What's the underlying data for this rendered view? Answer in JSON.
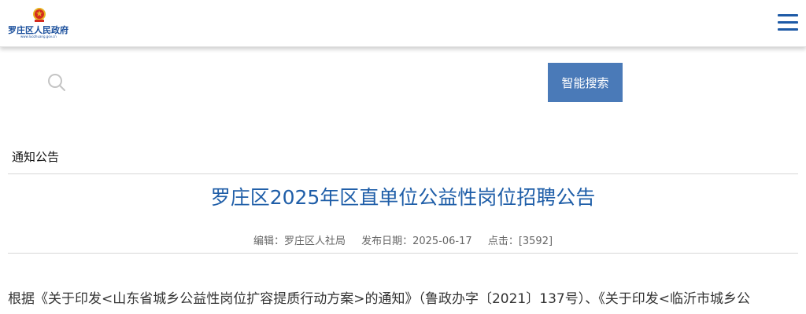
{
  "header": {
    "logo_title": "罗庄区人民政府",
    "logo_url": "www.luozhuang.gov.cn",
    "emblem_icon": "national-emblem-icon",
    "menu_icon": "hamburger-menu-icon"
  },
  "search": {
    "icon": "search-icon",
    "placeholder": "",
    "value": "",
    "button_label": "智能搜索"
  },
  "breadcrumb": {
    "label": "通知公告"
  },
  "article": {
    "title": "罗庄区2025年区直单位公益性岗位招聘公告",
    "editor": "编辑：罗庄区人社局",
    "date": "发布日期：2025-06-17",
    "hits": "点击：[3592]",
    "body_first_line": "根据《关于印发<山东省城乡公益性岗位扩容提质行动方案>的通知》（鲁政办字〔2021〕137号）、《关于印发<临沂市城乡公"
  },
  "colors": {
    "accent": "#1f5ea8",
    "search_button": "#4a7ab8",
    "emblem_red": "#d42b1e",
    "emblem_gold": "#e6b422"
  }
}
